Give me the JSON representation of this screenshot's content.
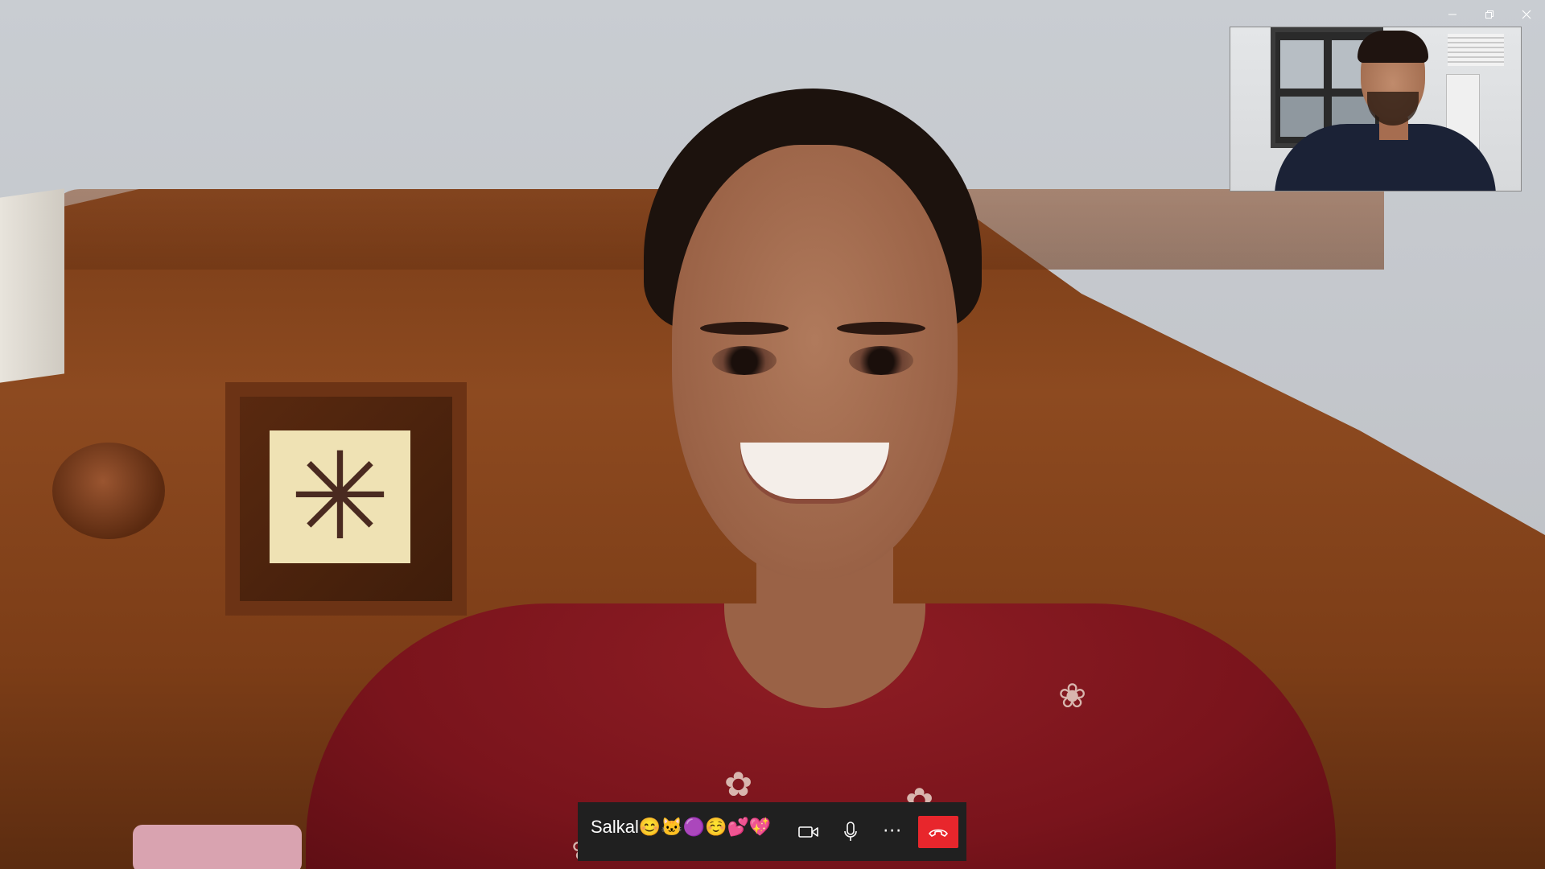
{
  "window": {
    "controls": {
      "minimize_icon": "minimize-icon",
      "restore_icon": "restore-icon",
      "close_icon": "close-icon"
    }
  },
  "call": {
    "caller_name": "Salkal😊🐱🟣☺️💕💖",
    "buttons": {
      "video_icon": "video-camera-icon",
      "mic_icon": "microphone-icon",
      "more_label": "···",
      "end_call_icon": "hang-up-icon"
    },
    "colors": {
      "toolbar_bg": "#202020",
      "end_call": "#e8262c",
      "icon": "#ffffff"
    }
  }
}
